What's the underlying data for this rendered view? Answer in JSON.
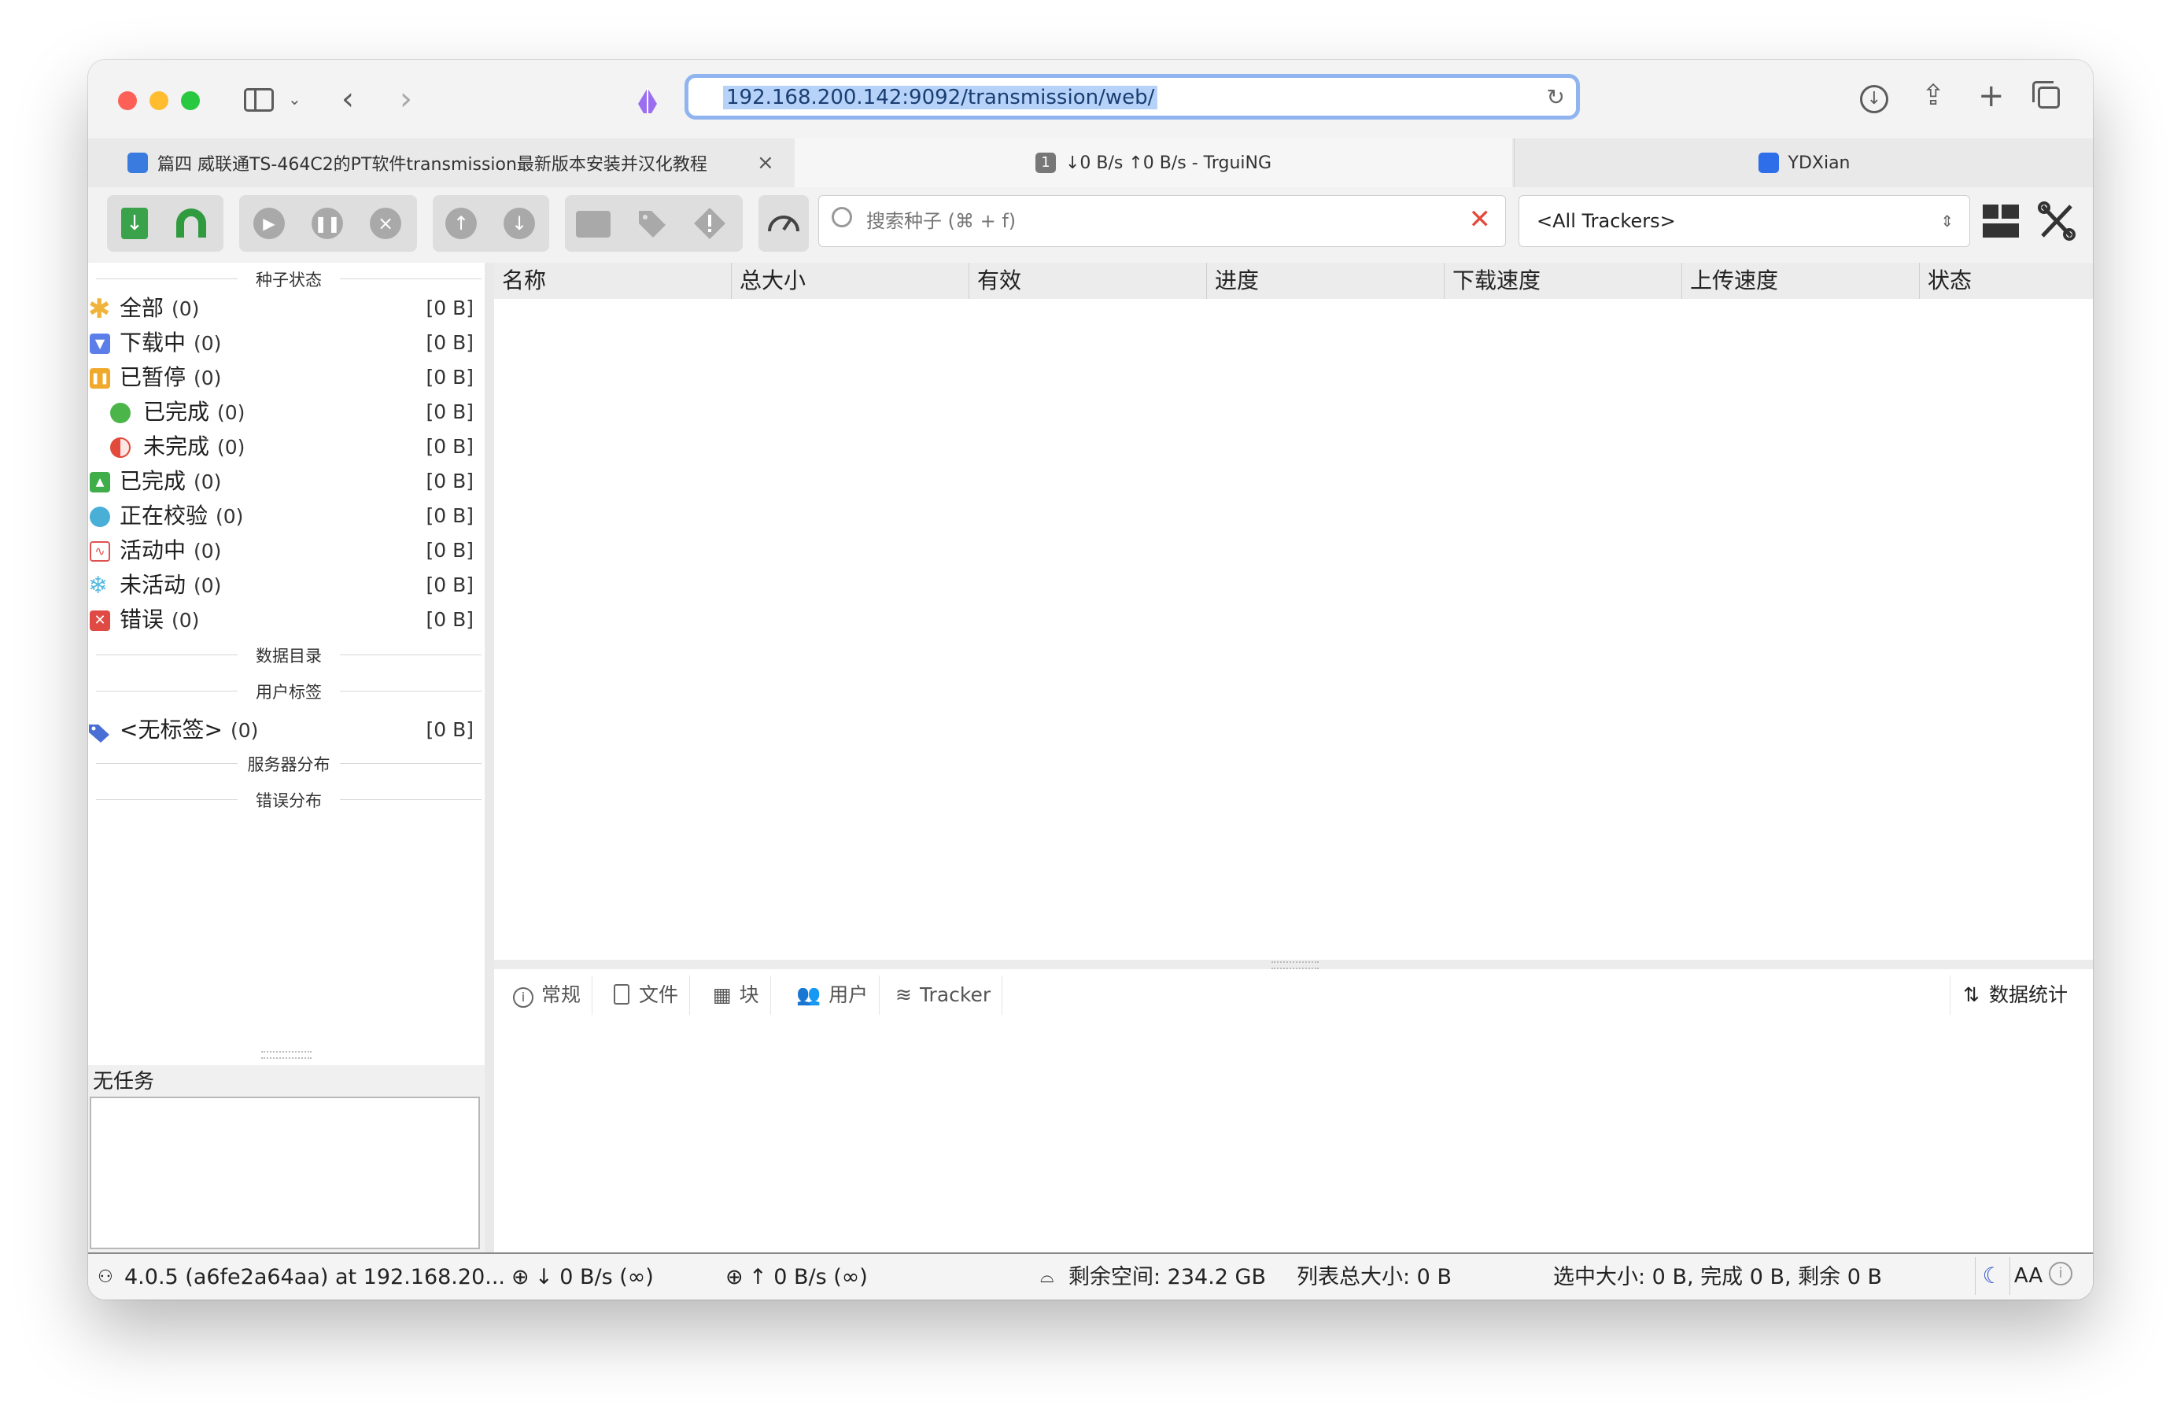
{
  "browser": {
    "url": "192.168.200.142:9092/transmission/web/",
    "tabs": [
      {
        "title": "篇四 威联通TS-464C2的PT软件transmission最新版本安装并汉化教程",
        "close": "×"
      },
      {
        "badge": "1",
        "title": "↓0 B/s ↑0 B/s - TrguiNG"
      },
      {
        "title": "YDXian"
      }
    ]
  },
  "toolbar": {
    "search_placeholder": "搜索种子 (⌘ + f)",
    "tracker_filter": "<All Trackers>"
  },
  "sidebar": {
    "status_header": "种子状态",
    "status_items": [
      {
        "label": "全部",
        "count": "(0)",
        "size": "[0 B]",
        "icon": "asterisk-icon",
        "color": "#f0b43c"
      },
      {
        "label": "下载中",
        "count": "(0)",
        "size": "[0 B]",
        "icon": "download-icon",
        "color": "#5b7ee8"
      },
      {
        "label": "已暂停",
        "count": "(0)",
        "size": "[0 B]",
        "icon": "pause-icon",
        "color": "#f0a92a"
      },
      {
        "label": "已完成",
        "count": "(0)",
        "size": "[0 B]",
        "icon": "green-dot-icon",
        "color": "#4cb54a"
      },
      {
        "label": "未完成",
        "count": "(0)",
        "size": "[0 B]",
        "icon": "half-circle-icon",
        "color": "#e24a3b"
      },
      {
        "label": "已完成",
        "count": "(0)",
        "size": "[0 B]",
        "icon": "upload-icon",
        "color": "#3fae4a"
      },
      {
        "label": "正在校验",
        "count": "(0)",
        "size": "[0 B]",
        "icon": "clock-icon",
        "color": "#4aafd6"
      },
      {
        "label": "活动中",
        "count": "(0)",
        "size": "[0 B]",
        "icon": "activity-icon",
        "color": "#e05252"
      },
      {
        "label": "未活动",
        "count": "(0)",
        "size": "[0 B]",
        "icon": "snowflake-icon",
        "color": "#57b9e0"
      },
      {
        "label": "错误",
        "count": "(0)",
        "size": "[0 B]",
        "icon": "error-icon",
        "color": "#e04a44"
      }
    ],
    "dir_header": "数据目录",
    "labels_header": "用户标签",
    "no_label": {
      "label": "<无标签>",
      "count": "(0)",
      "size": "[0 B]"
    },
    "servers_header": "服务器分布",
    "errors_header": "错误分布",
    "task_title": "无任务"
  },
  "table": {
    "columns": [
      "名称",
      "总大小",
      "有效",
      "进度",
      "下载速度",
      "上传速度",
      "状态"
    ]
  },
  "detail_tabs": {
    "items": [
      "常规",
      "文件",
      "块",
      "用户",
      "Tracker"
    ],
    "stats": "数据统计"
  },
  "statusbar": {
    "version": "4.0.5 (a6fe2a64aa) at 192.168.20...",
    "down": "↓ 0 B/s (∞)",
    "up": "↑ 0 B/s (∞)",
    "free_space": "剩余空间: 234.2 GB",
    "list_total": "列表总大小: 0 B",
    "selected": "选中大小: 0 B, 完成 0 B, 剩余 0 B",
    "font_toggle": "AA"
  }
}
